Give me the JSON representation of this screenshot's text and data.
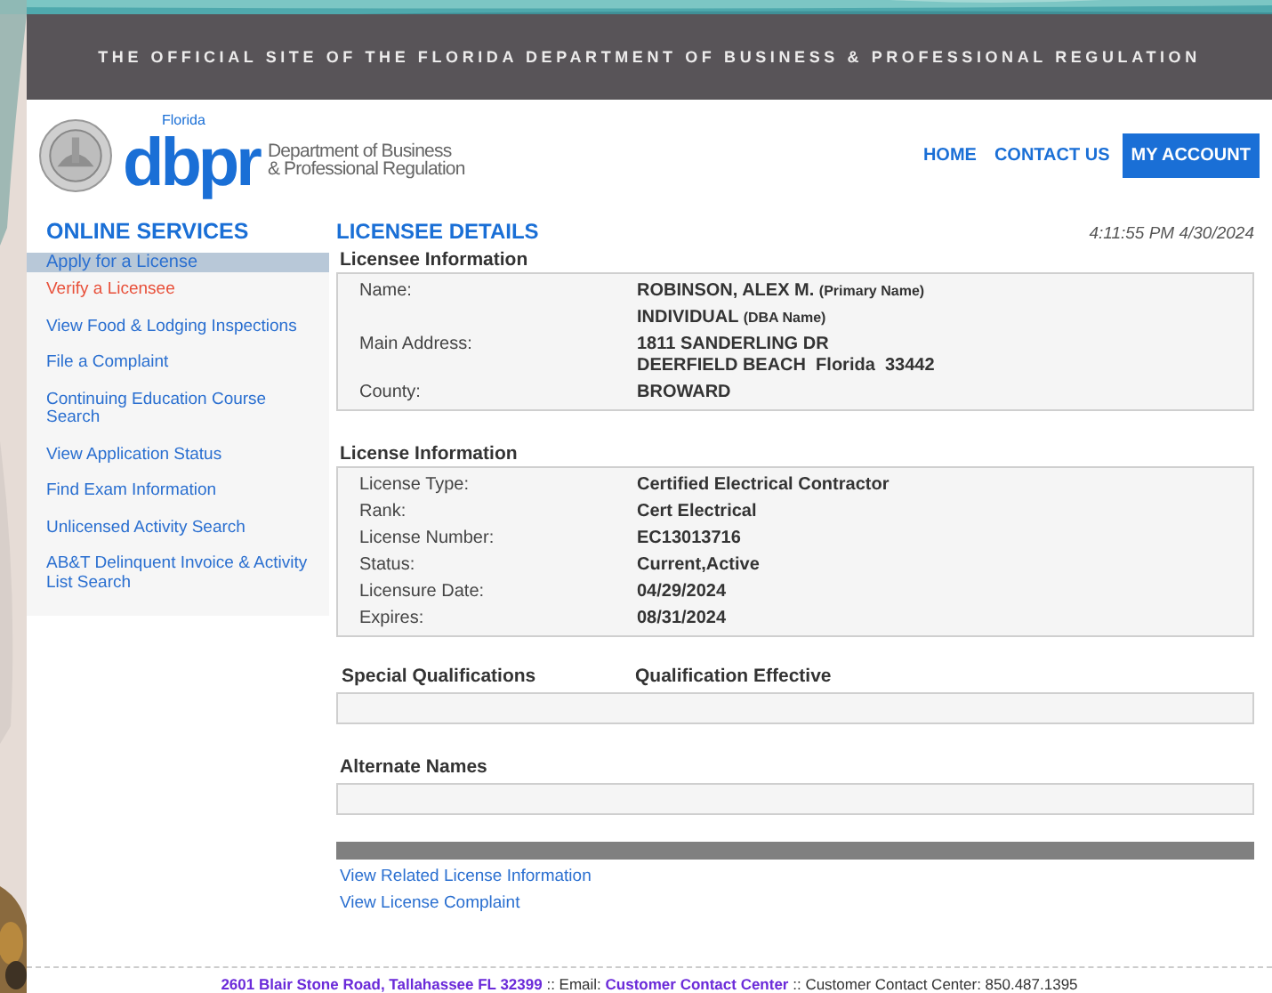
{
  "banner": {
    "text": "THE OFFICIAL SITE OF THE FLORIDA DEPARTMENT OF BUSINESS & PROFESSIONAL REGULATION"
  },
  "header": {
    "logo": {
      "state": "Florida",
      "wordmark": "dbpr",
      "department": [
        "Department of Business",
        "& Professional Regulation"
      ]
    },
    "nav": [
      {
        "label": "HOME",
        "kind": "link"
      },
      {
        "label": "CONTACT US",
        "kind": "link"
      },
      {
        "label": "MY ACCOUNT",
        "kind": "button"
      }
    ]
  },
  "sidebar": {
    "title": "ONLINE SERVICES",
    "items": [
      {
        "label": "Apply for a License",
        "selected": true,
        "current": false
      },
      {
        "label": "Verify a Licensee",
        "selected": false,
        "current": true
      },
      {
        "label": "View Food & Lodging Inspections",
        "selected": false,
        "current": false
      },
      {
        "label": "File a Complaint",
        "selected": false,
        "current": false
      },
      {
        "label": "Continuing Education Course Search",
        "selected": false,
        "current": false
      },
      {
        "label": "View Application Status",
        "selected": false,
        "current": false
      },
      {
        "label": "Find Exam Information",
        "selected": false,
        "current": false
      },
      {
        "label": "Unlicensed Activity Search",
        "selected": false,
        "current": false
      },
      {
        "label": "AB&T Delinquent Invoice & Activity List Search",
        "selected": false,
        "current": false
      }
    ]
  },
  "main": {
    "title": "LICENSEE DETAILS",
    "timestamp": "4:11:55 PM 4/30/2024",
    "licensee_information": {
      "heading": "Licensee Information",
      "rows": [
        {
          "label": "Name:",
          "lines": [
            "ROBINSON, ALEX M."
          ],
          "note": "(Primary Name)"
        },
        {
          "lines": [
            "INDIVIDUAL"
          ],
          "note": "(DBA Name)"
        },
        {
          "label": "Main Address:",
          "lines": [
            "1811 SANDERLING DR",
            "DEERFIELD BEACH  Florida  33442"
          ]
        },
        {
          "label": "County:",
          "lines": [
            "BROWARD"
          ]
        }
      ]
    },
    "license_information": {
      "heading": "License Information",
      "rows": [
        {
          "label": "License Type:",
          "lines": [
            "Certified Electrical Contractor"
          ]
        },
        {
          "label": "Rank:",
          "lines": [
            "Cert Electrical"
          ]
        },
        {
          "label": "License Number:",
          "lines": [
            "EC13013716"
          ]
        },
        {
          "label": "Status:",
          "lines": [
            "Current,Active"
          ]
        },
        {
          "label": "Licensure Date:",
          "lines": [
            "04/29/2024"
          ]
        },
        {
          "label": "Expires:",
          "lines": [
            "08/31/2024"
          ]
        }
      ]
    },
    "special_qualifications": {
      "columns": [
        "Special Qualifications",
        "Qualification Effective"
      ]
    },
    "alternate_names": {
      "heading": "Alternate Names"
    },
    "links": [
      "View Related License Information",
      "View License Complaint"
    ]
  },
  "footer": {
    "address": "2601 Blair Stone Road, Tallahassee FL 32399",
    "email_label": " :: Email: ",
    "email_link": "Customer Contact Center",
    "phone": " :: Customer Contact Center: 850.487.1395"
  }
}
